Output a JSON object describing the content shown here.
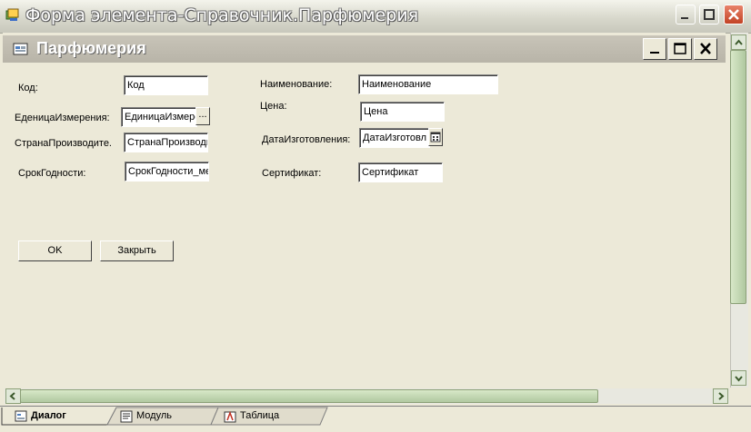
{
  "window": {
    "title": "Форма элемента-Справочник.Парфюмерия"
  },
  "form": {
    "title": "Парфюмерия",
    "fields": {
      "kod": {
        "label": "Код:",
        "value": "Код"
      },
      "unit": {
        "label": "ЕденицаИзмерения:",
        "value": "ЕдиницаИзмере",
        "button": "..."
      },
      "country": {
        "label": "СтранаПроизводите.",
        "value": "СтранаПроизводи"
      },
      "expiry": {
        "label": "СрокГодности:",
        "value": "СрокГодности_ме"
      },
      "name": {
        "label": "Наименование:",
        "value": "Наименование"
      },
      "price": {
        "label": "Цена:",
        "value": "Цена"
      },
      "date": {
        "label": "ДатаИзготовления:",
        "value": "ДатаИзготовл"
      },
      "cert": {
        "label": "Сертификат:",
        "value": "Сертификат"
      }
    },
    "buttons": {
      "ok": "OK",
      "close": "Закрыть"
    }
  },
  "tabs": [
    {
      "label": "Диалог",
      "icon": "dialog-icon",
      "active": true
    },
    {
      "label": "Модуль",
      "icon": "module-icon",
      "active": false
    },
    {
      "label": "Таблица",
      "icon": "table-icon",
      "active": false
    }
  ],
  "colors": {
    "close_button": "#c24224",
    "scroll_thumb": "#b0c8a0"
  }
}
